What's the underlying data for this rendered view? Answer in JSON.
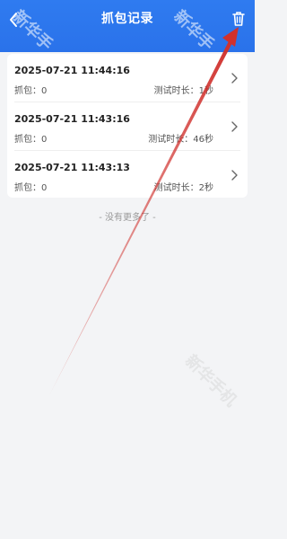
{
  "header": {
    "title": "抓包记录",
    "back_icon": "chevron-left-icon",
    "delete_icon": "trash-icon"
  },
  "records": [
    {
      "time": "2025-07-21 11:44:16",
      "capture_label": "抓包：0",
      "duration_label": "测试时长：1秒"
    },
    {
      "time": "2025-07-21 11:43:16",
      "capture_label": "抓包：0",
      "duration_label": "测试时长：46秒"
    },
    {
      "time": "2025-07-21 11:43:13",
      "capture_label": "抓包：0",
      "duration_label": "测试时长：2秒"
    }
  ],
  "footer": {
    "no_more": "- 没有更多了 -"
  },
  "watermark": {
    "text": "新华手",
    "text2": "新华手机"
  },
  "colors": {
    "header": "#2f7bf0",
    "background": "#f3f4f6",
    "annotation_arrow": "#d0312d"
  }
}
